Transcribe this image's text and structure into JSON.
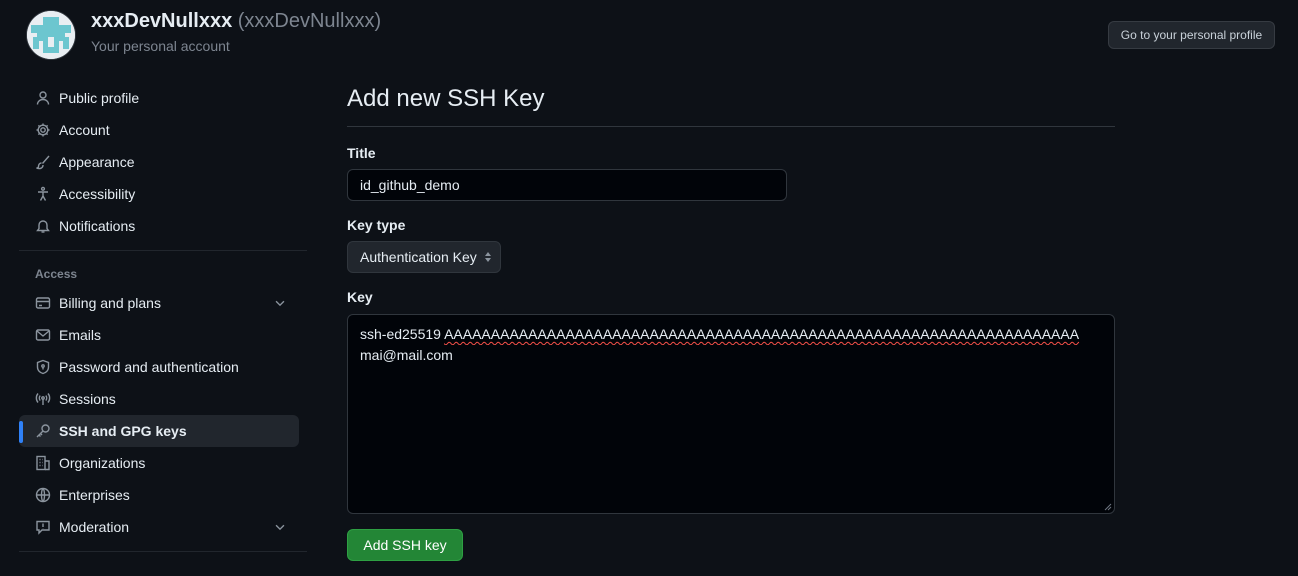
{
  "header": {
    "display_name": "xxxDevNullxxx",
    "login": "(xxxDevNullxxx)",
    "account_type": "Your personal account",
    "profile_button": "Go to your personal profile"
  },
  "sidebar": {
    "items": [
      {
        "label": "Public profile",
        "icon": "person-icon"
      },
      {
        "label": "Account",
        "icon": "gear-icon"
      },
      {
        "label": "Appearance",
        "icon": "paintbrush-icon"
      },
      {
        "label": "Accessibility",
        "icon": "accessibility-icon"
      },
      {
        "label": "Notifications",
        "icon": "bell-icon"
      }
    ],
    "access_label": "Access",
    "access_items": [
      {
        "label": "Billing and plans",
        "icon": "credit-card-icon",
        "expandable": true
      },
      {
        "label": "Emails",
        "icon": "mail-icon"
      },
      {
        "label": "Password and authentication",
        "icon": "shield-lock-icon"
      },
      {
        "label": "Sessions",
        "icon": "broadcast-icon"
      },
      {
        "label": "SSH and GPG keys",
        "icon": "key-icon",
        "selected": true
      },
      {
        "label": "Organizations",
        "icon": "organization-icon"
      },
      {
        "label": "Enterprises",
        "icon": "globe-icon"
      },
      {
        "label": "Moderation",
        "icon": "report-icon",
        "expandable": true
      }
    ]
  },
  "form": {
    "heading": "Add new SSH Key",
    "title_label": "Title",
    "title_value": "id_github_demo",
    "key_type_label": "Key type",
    "key_type_value": "Authentication Key",
    "key_label": "Key",
    "key_prefix": "ssh-ed25519",
    "key_body": "AAAAAAAAAAAAAAAAAAAAAAAAAAAAAAAAAAAAAAAAAAAAAAAAAAAAAAAAAAAAAAAAAAAA",
    "key_comment": "mai@mail.com",
    "submit_label": "Add SSH key"
  },
  "colors": {
    "background": "#0d1117",
    "accent": "#2f81f7",
    "primary_button": "#238636"
  }
}
